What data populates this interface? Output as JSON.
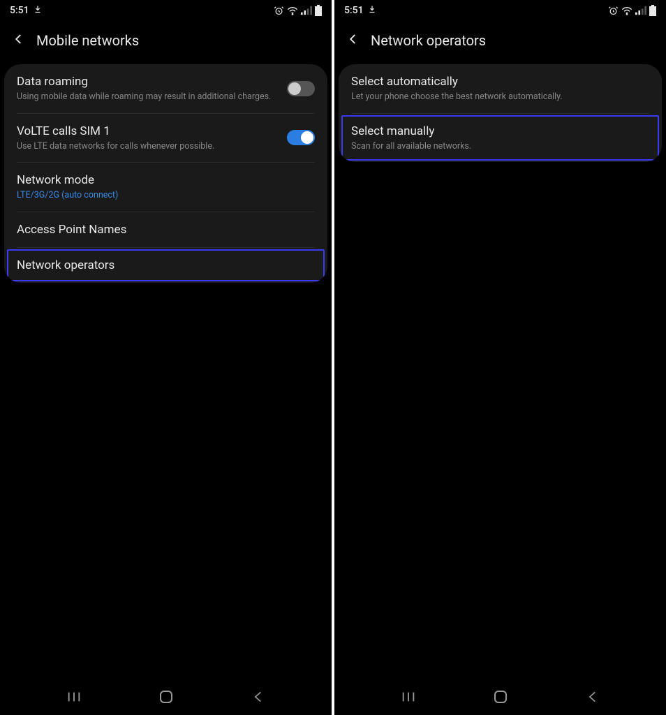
{
  "status": {
    "time": "5:51"
  },
  "screen1": {
    "title": "Mobile networks",
    "rows": {
      "roaming": {
        "title": "Data roaming",
        "sub": "Using mobile data while roaming may result in additional charges."
      },
      "volte": {
        "title": "VoLTE calls SIM 1",
        "sub": "Use LTE data networks for calls whenever possible."
      },
      "mode": {
        "title": "Network mode",
        "sub": "LTE/3G/2G (auto connect)"
      },
      "apn": {
        "title": "Access Point Names"
      },
      "operators": {
        "title": "Network operators"
      }
    }
  },
  "screen2": {
    "title": "Network operators",
    "rows": {
      "auto": {
        "title": "Select automatically",
        "sub": "Let your phone choose the best network automatically."
      },
      "manual": {
        "title": "Select manually",
        "sub": "Scan for all available networks."
      }
    }
  }
}
